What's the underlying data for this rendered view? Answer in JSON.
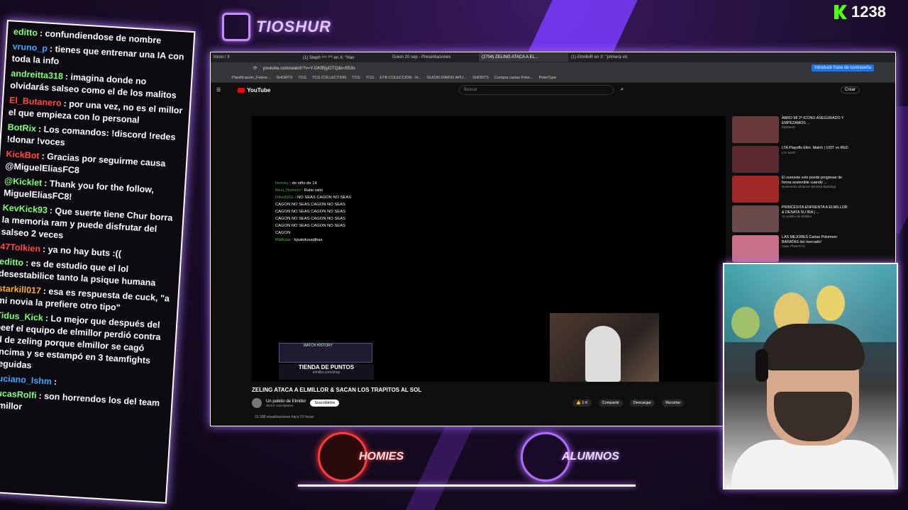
{
  "stream": {
    "brand": "TIOSHUR",
    "viewer_count": "1238"
  },
  "chat": [
    {
      "user": "editto",
      "text": "confundiendose de nombre",
      "color": "#7fff7a"
    },
    {
      "user": "vruno_p",
      "text": "tienes que entrenar una IA con toda la info",
      "color": "#3fa9ff"
    },
    {
      "user": "andreitta318",
      "text": "imagina donde no olvidarás salseo como el de los malitos",
      "color": "#7fff7a"
    },
    {
      "user": "El_Butanero",
      "text": "por una vez, no es el millor el que empieza con lo personal",
      "color": "#ff4b3e"
    },
    {
      "user": "BotRix",
      "text": "Los comandos: !discord !redes !donar !voces",
      "color": "#7fff7a"
    },
    {
      "user": "KickBot",
      "text": "Gracias por seguirme causa @MiguelEliasFC8",
      "color": "#ff4b3e"
    },
    {
      "user": "@Kicklet",
      "text": "Thank you for the follow, MiguelEliasFC8!",
      "color": "#7fff7a"
    },
    {
      "user": "KevKick93",
      "text": "Que suerte tiene Chur borra la memoria ram y puede disfrutar del salseo 2 veces",
      "color": "#7fff7a"
    },
    {
      "user": "47Tolkien",
      "text": "ya no hay buts :((",
      "color": "#ff4b3e"
    },
    {
      "user": "editto",
      "text": "es de estudio que el lol desestabilice tanto la psique humana",
      "color": "#7fff7a"
    },
    {
      "user": "starkill017",
      "text": "esa es respuesta de cuck, \"a mi novia la prefiere otro tipo\"",
      "color": "#ffb020"
    },
    {
      "user": "Tidus_Kick",
      "text": "Lo mejor que después del beef el equipo de elmillor perdió contra el de zeling porque elmillor se cagó encima y se estampó en 3 teamfights seguidas",
      "color": "#7fff7a"
    },
    {
      "user": "Luciano_Ishm",
      "text": "",
      "color": "#3fa9ff"
    },
    {
      "user": "LucasRolfi",
      "text": "son horrendos los del team elmillor",
      "color": "#7fff7a"
    }
  ],
  "browser": {
    "tabs": [
      "Inicio / X",
      "(1) Steph ⁸⁴¹ ¹⁰⁰ en X: \"Han",
      "Guion 20 sep - Presentaciones",
      "(2704) ZELING ATACA A EL...",
      "(1) ElmilloR en X: \"primera vic"
    ],
    "url": "youtube.com/watch?v=Y-DKfBjyDTQ&t=553s",
    "password_btn": "Introducir frase de contraseña",
    "bookmarks": [
      "Planificación_Febrer...",
      "SHORTS",
      "TCG",
      "TCG COLLECTION",
      "TCG",
      "TCG",
      "ETB COLECCION - H...",
      "GUION DIARIO APLI...",
      "SHORTS",
      "Compra cartas Poke...",
      "PokeType"
    ]
  },
  "youtube": {
    "logo": "YouTube",
    "search_placeholder": "Buscar",
    "create_label": "Crear",
    "overlay_chat": [
      {
        "user": "hernivy",
        "text": "de niño de 14"
      },
      {
        "user": "Real_Numero",
        "text": "Ratio ratio"
      },
      {
        "user": "D4vidSGL",
        "text": "NO SEAS CAGON  NO SEAS CAGON  NO SEAS CAGON  NO SEAS CAGON  NO SEAS CAGON  NO SEAS CAGON  NO SEAS CAGON  NO SEAS CAGON  NO SEAS CAGON  NO SEAS CAGON"
      },
      {
        "user": "Matfuias",
        "text": "kjsakdusadjhas"
      }
    ],
    "match_history": "MATCH HISTORY",
    "tienda": "TIENDA DE PUNTOS",
    "tienda_url": "elmillor.com/shop",
    "video_title": "ZELING ATACA A ELMILLOR & SACAN LOS TRAPITOS AL SOL",
    "channel": "Un polkito de Elmillor",
    "subs": "30,9 K suscriptores",
    "subscribe": "Suscribirme",
    "likes": "1 K",
    "share": "Compartir",
    "download": "Descargar",
    "clip": "Recortar",
    "views": "31.308 visualizaciones  hace 23 horas",
    "related": [
      {
        "title": "ABRO MI 2º ICONO ASEGURADO Y EMPEZAMOS ...",
        "meta": "ElpikaHD",
        "color": "#6a3a3a"
      },
      {
        "title": "LTA Playoffs Elim. Match | 100T vs RED",
        "meta": "LTA North",
        "color": "#5a2a30"
      },
      {
        "title": "El suresste solo puede progresar de forma sostenible cuando ...",
        "meta": "Nosemeka Obianzei (Emeka Banking)",
        "color": "#a02828"
      },
      {
        "title": "PRINCESITA ENFRENTA A ELMILLOR & DESATA SU IRA | ...",
        "meta": "Un polkito de Elmillor",
        "color": "#6a4a4a"
      },
      {
        "title": "LAS MEJORES Cartas Pokémon BARATAS del mercado!",
        "meta": "Isaac PhotoTCG",
        "color": "#c8708a"
      }
    ]
  },
  "teams": [
    {
      "name": "HOMIES",
      "color": "#ff3a3a"
    },
    {
      "name": "ALUMNOS",
      "color": "#b06bff"
    }
  ]
}
